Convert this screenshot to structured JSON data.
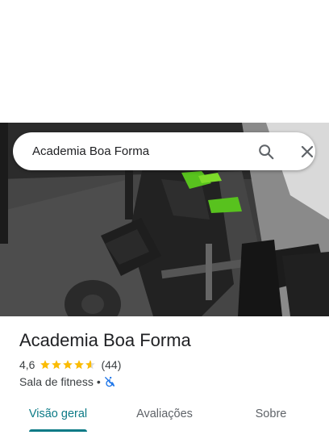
{
  "search": {
    "query": "Academia Boa Forma"
  },
  "place": {
    "name": "Academia Boa Forma",
    "rating": "4,6",
    "stars": 4.6,
    "review_count": "(44)",
    "category": "Sala de fitness",
    "separator": "•"
  },
  "tabs": [
    {
      "label": "Visão geral",
      "active": true
    },
    {
      "label": "Avaliações",
      "active": false
    },
    {
      "label": "Sobre",
      "active": false
    }
  ],
  "colors": {
    "accent": "#0b7a86",
    "star": "#fbbc04",
    "accessibility": "#1a73e8"
  },
  "icons": {
    "search": "search-icon",
    "close": "close-icon",
    "accessibility": "wheelchair-not-accessible-icon"
  }
}
